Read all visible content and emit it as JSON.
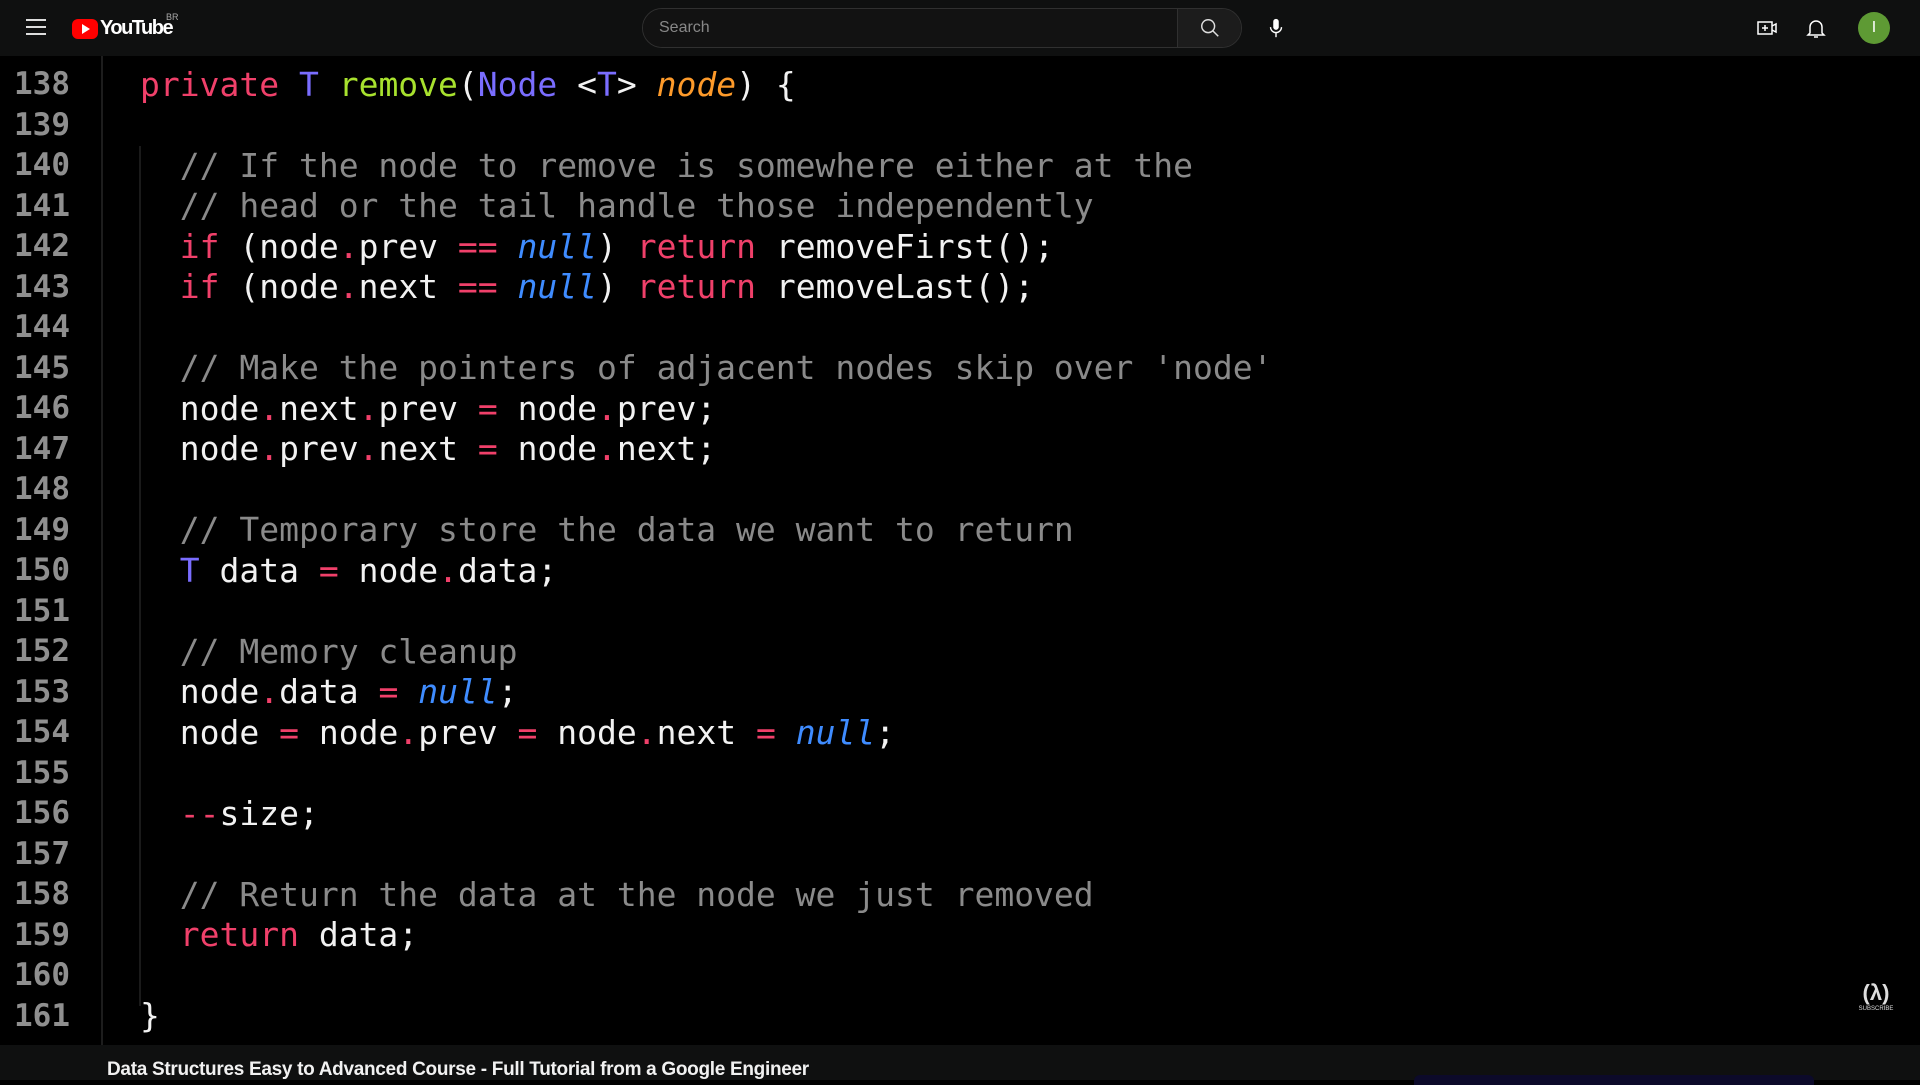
{
  "header": {
    "logo_text": "YouTube",
    "country_code": "BR",
    "search_placeholder": "Search",
    "avatar_letter": "I",
    "icons": [
      "menu-icon",
      "youtube-logo",
      "search-icon",
      "mic-icon",
      "create-icon",
      "bell-icon"
    ]
  },
  "video": {
    "title": "Data Structures Easy to Advanced Course - Full Tutorial from a Google Engineer",
    "watermark": {
      "glyph": "(λ)",
      "label": "SUBSCRIBE"
    },
    "code_lines": [
      {
        "n": "138",
        "t": [
          [
            "kw",
            "private "
          ],
          [
            "ty",
            "T "
          ],
          [
            "fn",
            "remove"
          ],
          [
            "tx",
            "("
          ],
          [
            "ty",
            "Node "
          ],
          [
            "tx",
            "<"
          ],
          [
            "ty",
            "T"
          ],
          [
            "tx",
            "> "
          ],
          [
            "par",
            "node"
          ],
          [
            "tx",
            ") {"
          ]
        ],
        "i": 0
      },
      {
        "n": "139",
        "t": [],
        "i": 0
      },
      {
        "n": "140",
        "t": [
          [
            "cm",
            "// If the node to remove is somewhere either at the"
          ]
        ],
        "i": 1
      },
      {
        "n": "141",
        "t": [
          [
            "cm",
            "// head or the tail handle those independently"
          ]
        ],
        "i": 1
      },
      {
        "n": "142",
        "t": [
          [
            "kw",
            "if "
          ],
          [
            "tx",
            "(node"
          ],
          [
            "op",
            "."
          ],
          [
            "tx",
            "prev "
          ],
          [
            "op",
            "== "
          ],
          [
            "nl",
            "null"
          ],
          [
            "tx",
            ") "
          ],
          [
            "kw",
            "return "
          ],
          [
            "tx",
            "removeFirst();"
          ]
        ],
        "i": 1
      },
      {
        "n": "143",
        "t": [
          [
            "kw",
            "if "
          ],
          [
            "tx",
            "(node"
          ],
          [
            "op",
            "."
          ],
          [
            "tx",
            "next "
          ],
          [
            "op",
            "== "
          ],
          [
            "nl",
            "null"
          ],
          [
            "tx",
            ") "
          ],
          [
            "kw",
            "return "
          ],
          [
            "tx",
            "removeLast();"
          ]
        ],
        "i": 1
      },
      {
        "n": "144",
        "t": [],
        "i": 1
      },
      {
        "n": "145",
        "t": [
          [
            "cm",
            "// Make the pointers of adjacent nodes skip over 'node'"
          ]
        ],
        "i": 1
      },
      {
        "n": "146",
        "t": [
          [
            "tx",
            "node"
          ],
          [
            "op",
            "."
          ],
          [
            "tx",
            "next"
          ],
          [
            "op",
            "."
          ],
          [
            "tx",
            "prev "
          ],
          [
            "op",
            "= "
          ],
          [
            "tx",
            "node"
          ],
          [
            "op",
            "."
          ],
          [
            "tx",
            "prev;"
          ]
        ],
        "i": 1
      },
      {
        "n": "147",
        "t": [
          [
            "tx",
            "node"
          ],
          [
            "op",
            "."
          ],
          [
            "tx",
            "prev"
          ],
          [
            "op",
            "."
          ],
          [
            "tx",
            "next "
          ],
          [
            "op",
            "= "
          ],
          [
            "tx",
            "node"
          ],
          [
            "op",
            "."
          ],
          [
            "tx",
            "next;"
          ]
        ],
        "i": 1
      },
      {
        "n": "148",
        "t": [],
        "i": 1
      },
      {
        "n": "149",
        "t": [
          [
            "cm",
            "// Temporary store the data we want to return"
          ]
        ],
        "i": 1
      },
      {
        "n": "150",
        "t": [
          [
            "ty",
            "T "
          ],
          [
            "tx",
            "data "
          ],
          [
            "op",
            "= "
          ],
          [
            "tx",
            "node"
          ],
          [
            "op",
            "."
          ],
          [
            "tx",
            "data;"
          ]
        ],
        "i": 1
      },
      {
        "n": "151",
        "t": [],
        "i": 1
      },
      {
        "n": "152",
        "t": [
          [
            "cm",
            "// Memory cleanup"
          ]
        ],
        "i": 1
      },
      {
        "n": "153",
        "t": [
          [
            "tx",
            "node"
          ],
          [
            "op",
            "."
          ],
          [
            "tx",
            "data "
          ],
          [
            "op",
            "= "
          ],
          [
            "nl",
            "null"
          ],
          [
            "tx",
            ";"
          ]
        ],
        "i": 1
      },
      {
        "n": "154",
        "t": [
          [
            "tx",
            "node "
          ],
          [
            "op",
            "= "
          ],
          [
            "tx",
            "node"
          ],
          [
            "op",
            "."
          ],
          [
            "tx",
            "prev "
          ],
          [
            "op",
            "= "
          ],
          [
            "tx",
            "node"
          ],
          [
            "op",
            "."
          ],
          [
            "tx",
            "next "
          ],
          [
            "op",
            "= "
          ],
          [
            "nl",
            "null"
          ],
          [
            "tx",
            ";"
          ]
        ],
        "i": 1
      },
      {
        "n": "155",
        "t": [],
        "i": 1
      },
      {
        "n": "156",
        "t": [
          [
            "op",
            "--"
          ],
          [
            "tx",
            "size;"
          ]
        ],
        "i": 1
      },
      {
        "n": "157",
        "t": [],
        "i": 1
      },
      {
        "n": "158",
        "t": [
          [
            "cm",
            "// Return the data at the node we just removed"
          ]
        ],
        "i": 1
      },
      {
        "n": "159",
        "t": [
          [
            "kw",
            "return "
          ],
          [
            "tx",
            "data;"
          ]
        ],
        "i": 1
      },
      {
        "n": "160",
        "t": [],
        "i": 0
      },
      {
        "n": "161",
        "t": [
          [
            "tx",
            "}"
          ]
        ],
        "i": 0
      }
    ]
  }
}
